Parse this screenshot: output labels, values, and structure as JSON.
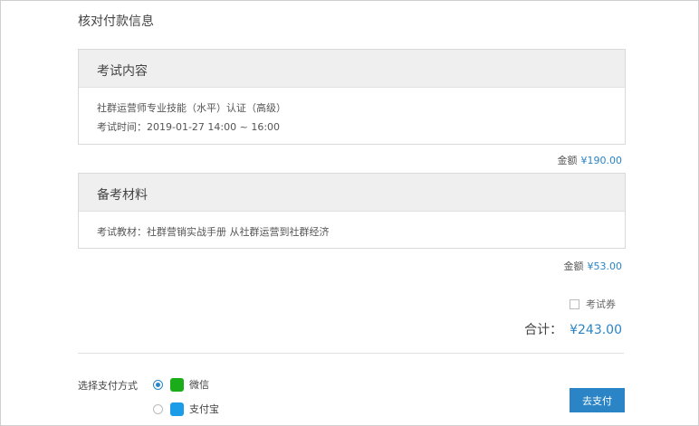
{
  "page": {
    "title": "核对付款信息"
  },
  "exam_section": {
    "title": "考试内容",
    "course_name": "社群运营师专业技能（水平）认证（高级）",
    "exam_time_label": "考试时间：",
    "exam_time_value": "2019-01-27 14:00 ~ 16:00",
    "amount_label": "金额",
    "amount_value": "¥190.00"
  },
  "materials_section": {
    "title": "备考材料",
    "material_line": "考试教材：社群营销实战手册 从社群运营到社群经济",
    "amount_label": "金额",
    "amount_value": "¥53.00"
  },
  "coupon": {
    "label": "考试券",
    "checked": false
  },
  "total": {
    "label": "合计：",
    "value": "¥243.00"
  },
  "payment": {
    "label": "选择支付方式",
    "options": [
      {
        "label": "微信",
        "icon": "wechat-icon",
        "selected": true
      },
      {
        "label": "支付宝",
        "icon": "alipay-icon",
        "selected": false
      }
    ],
    "pay_button": "去支付"
  },
  "colors": {
    "accent": "#2a84c6",
    "header_bg": "#efefef",
    "wechat": "#1aad19",
    "alipay": "#1b9ce8"
  }
}
